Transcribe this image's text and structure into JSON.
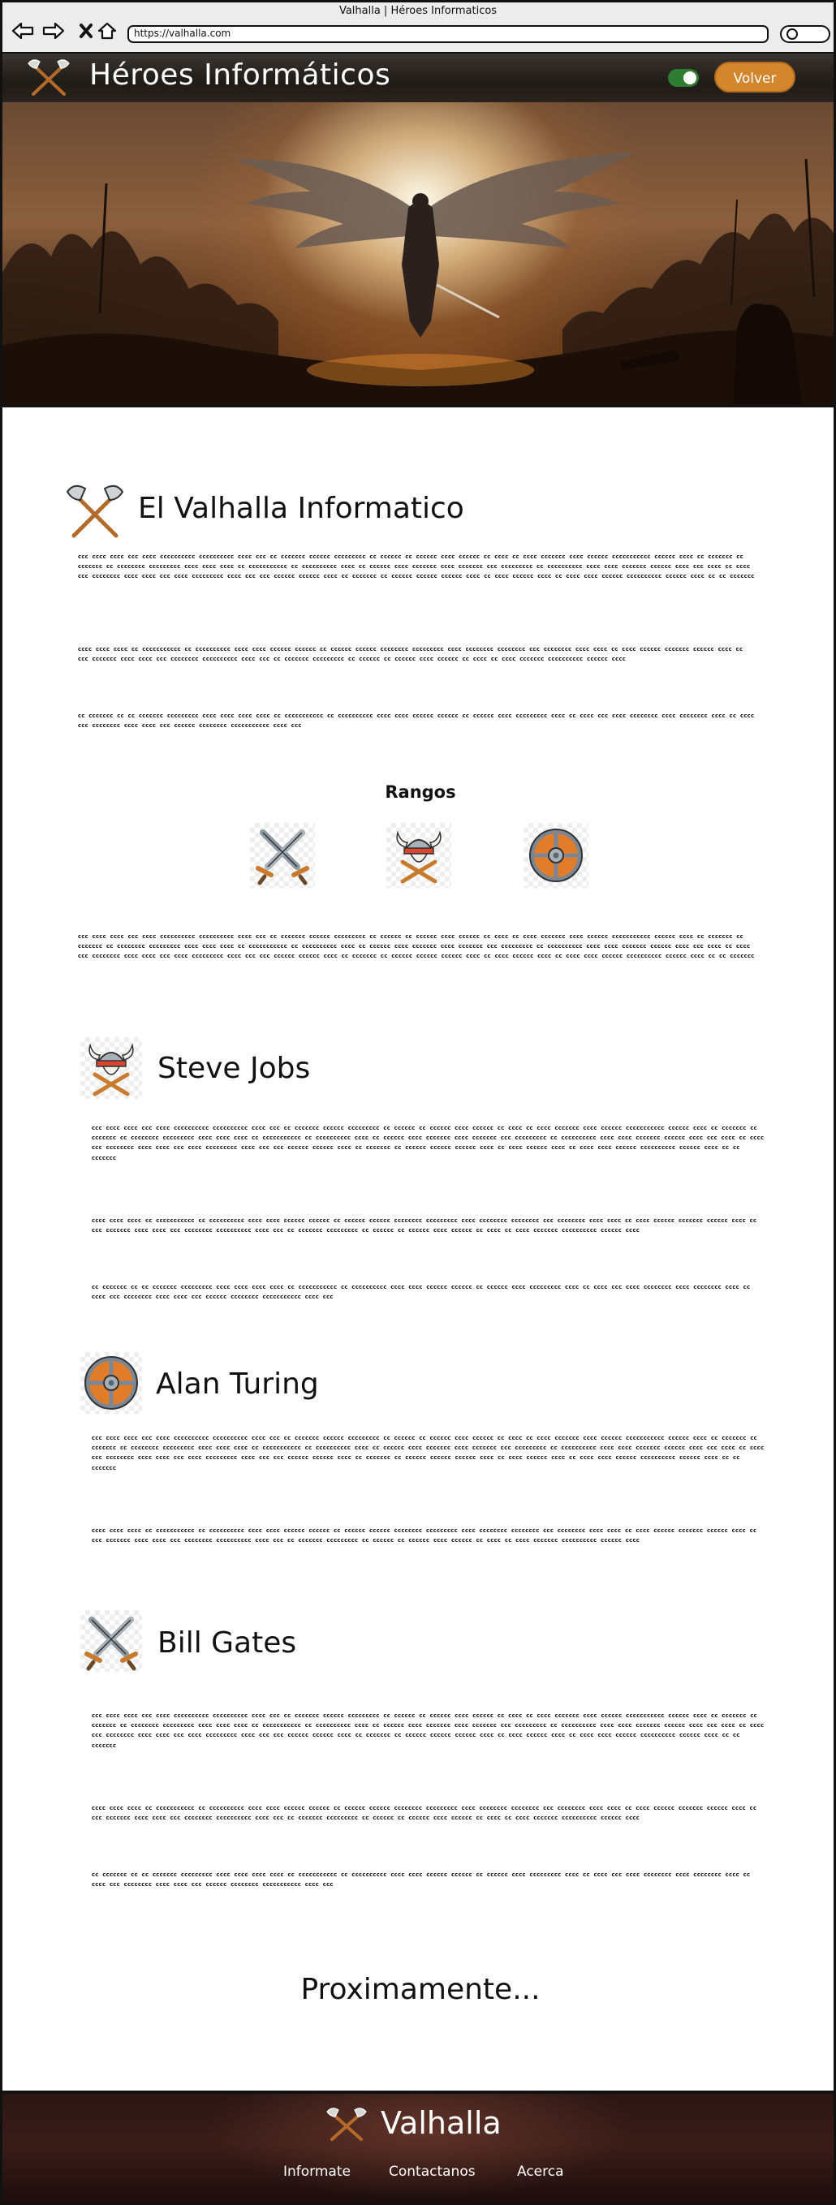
{
  "browser": {
    "window_title": "Valhalla | Héroes Informaticos",
    "url": "https://valhalla.com"
  },
  "header": {
    "brand": "Héroes Informáticos",
    "back_button": "Volver"
  },
  "intro": {
    "title": "El Valhalla Informatico",
    "paragraphs": [
      "ccc cccc cccc ccc cccc cccccccccc cccccccccc cccc ccc cc ccccccc cccccc ccccccccc cc cccccc cc cccccc cccc cccccc cc cccc cc cccc ccccccc cccc cccccc ccccccccccc cccccc cccc cc ccccccc cc ccccccc cc cccccccc ccccccccc cccc cccc cccc cc ccccccccccc cc cccccccccc cccc cc cccccc cccc ccccccc cccc ccccccc ccc ccccccccc cc cccccccccc cccc cccc ccccccc cccccc cccc ccc cccc cc cccc ccc cccccccc cccc cccc ccc cccc ccccccccc cccc ccc ccc cccccc cccccc cccc cc ccccccc cc cccccc cccccc cccccc cccc cc cccc cccccc cccc cc cccc cccc cccccc cccccccccc cccccc cccc cc cc ccccccc",
      "cccc cccc cccc cc ccccccccccc cc cccccccccc cccc cccc cccccc cccccc cc cccccc cccccc cccccccc ccccccccc cccc cccccccc cccccccc ccc cccccccc cccc cccc cc cccc cccccc ccccccc cccccc cccc cc ccc ccccccc cccc cccc ccc cccccccc cccccccccc cccc ccc cc ccccccc ccccccccc cc cccccc cc cccccc cccc cccccc cc cccc cc cccc ccccccc cccccccccc cccccc cccc",
      "cc ccccccc cc cc ccccccc ccccccccc cccc cccc cccc cccc cc ccccccccccc cc cccccccccc cccc cccc cccccc cccccc cc cccccc cccc ccccccccc cccc cc cccc ccc cccc cccccccc cccc cccccccc cccc cc cccc ccc cccccccc cccc cccc ccc cccccc cccccccc ccccccccccc cccc ccc"
    ]
  },
  "ranks": {
    "title": "Rangos",
    "icons": [
      "crossed-swords-icon",
      "viking-helmet-icon",
      "round-shield-icon"
    ],
    "paragraph": "ccc cccc cccc ccc cccc cccccccccc cccccccccc cccc ccc cc ccccccc cccccc ccccccccc cc cccccc cc cccccc cccc cccccc cc cccc cc cccc ccccccc cccc cccccc ccccccccccc cccccc cccc cc ccccccc cc ccccccc cc cccccccc ccccccccc cccc cccc cccc cc ccccccccccc cc cccccccccc cccc cc cccccc cccc ccccccc cccc ccccccc ccc ccccccccc cc cccccccccc cccc cccc ccccccc cccccc cccc ccc cccc cc cccc ccc cccccccc cccc cccc ccc cccc ccccccccc cccc ccc ccc cccccc cccccc cccc cc ccccccc cc cccccc cccccc cccccc cccc cc cccc cccccc cccc cc cccc cccc cccccc cccccccccc cccccc cccc cc cc ccccccc"
  },
  "heroes": [
    {
      "name": "Steve Jobs",
      "icon": "viking-helmet-icon",
      "paragraphs": [
        "ccc cccc cccc ccc cccc cccccccccc cccccccccc cccc ccc cc ccccccc cccccc ccccccccc cc cccccc cc cccccc cccc cccccc cc cccc cc cccc ccccccc cccc cccccc ccccccccccc cccccc cccc cc ccccccc cc ccccccc cc cccccccc ccccccccc cccc cccc cccc cc ccccccccccc cc cccccccccc cccc cc cccccc cccc ccccccc cccc ccccccc ccc ccccccccc cc cccccccccc cccc cccc ccccccc cccccc cccc ccc cccc cc cccc ccc cccccccc cccc cccc ccc cccc ccccccccc cccc ccc ccc cccccc cccccc cccc cc ccccccc cc cccccc cccccc cccccc cccc cc cccc cccccc cccc cc cccc cccc cccccc cccccccccc cccccc cccc cc cc ccccccc",
        "cccc cccc cccc cc ccccccccccc cc cccccccccc cccc cccc cccccc cccccc cc cccccc cccccc cccccccc ccccccccc cccc cccccccc cccccccc ccc cccccccc cccc cccc cc cccc cccccc ccccccc cccccc cccc cc ccc ccccccc cccc cccc ccc cccccccc cccccccccc cccc ccc cc ccccccc ccccccccc cc cccccc cc cccccc cccc cccccc cc cccc cc cccc ccccccc cccccccccc cccccc cccc",
        "cc ccccccc cc cc ccccccc ccccccccc cccc cccc cccc cccc cc ccccccccccc cc cccccccccc cccc cccc cccccc cccccc cc cccccc cccc ccccccccc cccc cc cccc ccc cccc cccccccc cccc cccccccc cccc cc cccc ccc cccccccc cccc cccc ccc cccccc cccccccc ccccccccccc cccc ccc"
      ]
    },
    {
      "name": "Alan Turing",
      "icon": "round-shield-icon",
      "paragraphs": [
        "ccc cccc cccc ccc cccc cccccccccc cccccccccc cccc ccc cc ccccccc cccccc ccccccccc cc cccccc cc cccccc cccc cccccc cc cccc cc cccc ccccccc cccc cccccc ccccccccccc cccccc cccc cc ccccccc cc ccccccc cc cccccccc ccccccccc cccc cccc cccc cc ccccccccccc cc cccccccccc cccc cc cccccc cccc ccccccc cccc ccccccc ccc ccccccccc cc cccccccccc cccc cccc ccccccc cccccc cccc ccc cccc cc cccc ccc cccccccc cccc cccc ccc cccc ccccccccc cccc ccc ccc cccccc cccccc cccc cc ccccccc cc cccccc cccccc cccccc cccc cc cccc cccccc cccc cc cccc cccc cccccc cccccccccc cccccc cccc cc cc ccccccc",
        "cccc cccc cccc cc ccccccccccc cc cccccccccc cccc cccc cccccc cccccc cc cccccc cccccc cccccccc ccccccccc cccc cccccccc cccccccc ccc cccccccc cccc cccc cc cccc cccccc ccccccc cccccc cccc cc ccc ccccccc cccc cccc ccc cccccccc cccccccccc cccc ccc cc ccccccc ccccccccc cc cccccc cc cccccc cccc cccccc cc cccc cc cccc ccccccc cccccccccc cccccc cccc"
      ]
    },
    {
      "name": "Bill Gates",
      "icon": "crossed-swords-icon",
      "paragraphs": [
        "ccc cccc cccc ccc cccc cccccccccc cccccccccc cccc ccc cc ccccccc cccccc ccccccccc cc cccccc cc cccccc cccc cccccc cc cccc cc cccc ccccccc cccc cccccc ccccccccccc cccccc cccc cc ccccccc cc ccccccc cc cccccccc ccccccccc cccc cccc cccc cc ccccccccccc cc cccccccccc cccc cc cccccc cccc ccccccc cccc ccccccc ccc ccccccccc cc cccccccccc cccc cccc ccccccc cccccc cccc ccc cccc cc cccc ccc cccccccc cccc cccc ccc cccc ccccccccc cccc ccc ccc cccccc cccccc cccc cc ccccccc cc cccccc cccccc cccccc cccc cc cccc cccccc cccc cc cccc cccc cccccc cccccccccc cccccc cccc cc cc ccccccc",
        "cccc cccc cccc cc ccccccccccc cc cccccccccc cccc cccc cccccc cccccc cc cccccc cccccc cccccccc ccccccccc cccc cccccccc cccccccc ccc cccccccc cccc cccc cc cccc cccccc ccccccc cccccc cccc cc ccc ccccccc cccc cccc ccc cccccccc cccccccccc cccc ccc cc ccccccc ccccccccc cc cccccc cc cccccc cccc cccccc cc cccc cc cccc ccccccc cccccccccc cccccc cccc",
        "cc ccccccc cc cc ccccccc ccccccccc cccc cccc cccc cccc cc ccccccccccc cc cccccccccc cccc cccc cccccc cccccc cc cccccc cccc ccccccccc cccc cc cccc ccc cccc cccccccc cccc cccccccc cccc cc cccc ccc cccccccc cccc cccc ccc cccccc cccccccc ccccccccccc cccc ccc"
      ]
    }
  ],
  "coming_soon": "Proximamente...",
  "footer": {
    "brand": "Valhalla",
    "links": [
      "Informate",
      "Contactanos",
      "Acerca"
    ]
  },
  "colors": {
    "accent_orange": "#d4862c",
    "toggle_green": "#2e7d32",
    "header_dark": "#1f1b18",
    "footer_dark": "#2a1614"
  }
}
